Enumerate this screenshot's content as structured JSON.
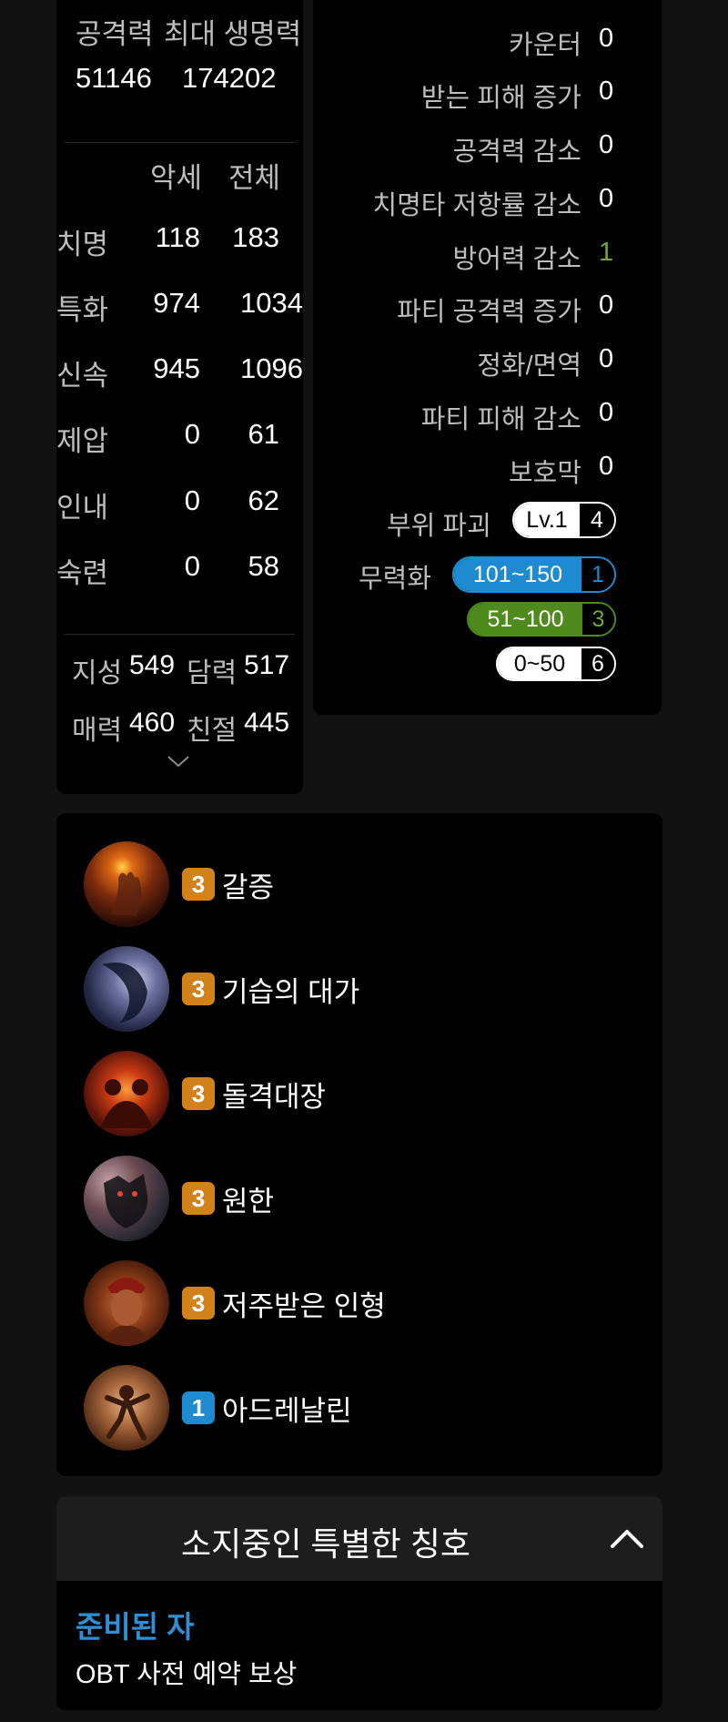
{
  "left": {
    "header_labels": [
      "공격력",
      "최대 생명력"
    ],
    "header_values": [
      "51146",
      "174202"
    ],
    "col_headers": [
      "악세",
      "전체"
    ],
    "stats": [
      {
        "label": "치명",
        "acc": "118",
        "total": "183"
      },
      {
        "label": "특화",
        "acc": "974",
        "total": "1034"
      },
      {
        "label": "신속",
        "acc": "945",
        "total": "1096"
      },
      {
        "label": "제압",
        "acc": "0",
        "total": "61"
      },
      {
        "label": "인내",
        "acc": "0",
        "total": "62"
      },
      {
        "label": "숙련",
        "acc": "0",
        "total": "58"
      }
    ],
    "base": [
      {
        "label": "지성",
        "value": "549"
      },
      {
        "label": "담력",
        "value": "517"
      },
      {
        "label": "매력",
        "value": "460"
      },
      {
        "label": "친절",
        "value": "445"
      }
    ]
  },
  "right": {
    "buffs": [
      {
        "label": "카운터",
        "value": "0"
      },
      {
        "label": "받는 피해 증가",
        "value": "0"
      },
      {
        "label": "공격력 감소",
        "value": "0"
      },
      {
        "label": "치명타 저항률 감소",
        "value": "0"
      },
      {
        "label": "방어력 감소",
        "value": "1"
      },
      {
        "label": "파티 공격력 증가",
        "value": "0"
      },
      {
        "label": "정화/면역",
        "value": "0"
      },
      {
        "label": "파티 피해 감소",
        "value": "0"
      },
      {
        "label": "보호막",
        "value": "0"
      }
    ],
    "part_break": {
      "label": "부위 파괴",
      "level": "Lv.1",
      "count": "4"
    },
    "stagger": {
      "label": "무력화",
      "tiers": [
        {
          "range": "101~150",
          "count": "1",
          "color": "#1e8bd0"
        },
        {
          "range": "51~100",
          "count": "3",
          "color": "#4f8a1c"
        },
        {
          "range": "0~50",
          "count": "6",
          "color": "#ffffff"
        }
      ]
    }
  },
  "engravings": [
    {
      "level": "3",
      "name": "갈증",
      "icon": "thirst-icon",
      "badge_color": "#d2821b"
    },
    {
      "level": "3",
      "name": "기습의 대가",
      "icon": "ambush-master-icon",
      "badge_color": "#d2821b"
    },
    {
      "level": "3",
      "name": "돌격대장",
      "icon": "vanguard-icon",
      "badge_color": "#d2821b"
    },
    {
      "level": "3",
      "name": "원한",
      "icon": "grudge-icon",
      "badge_color": "#d2821b"
    },
    {
      "level": "3",
      "name": "저주받은 인형",
      "icon": "cursed-doll-icon",
      "badge_color": "#d2821b"
    },
    {
      "level": "1",
      "name": "아드레날린",
      "icon": "adrenaline-icon",
      "badge_color": "#1e8bd0"
    }
  ],
  "titles": {
    "header": "소지중인 특별한 칭호",
    "title_name": "준비된 자",
    "title_desc": "OBT 사전 예약 보상",
    "accent": "#2f8fd5"
  }
}
